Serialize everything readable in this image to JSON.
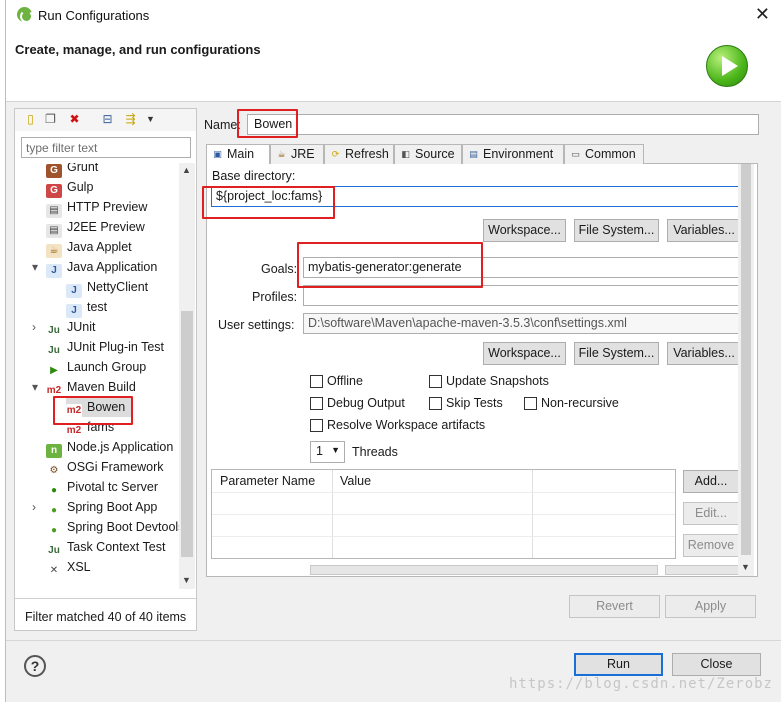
{
  "window": {
    "title": "Run Configurations",
    "close_glyph": "✕"
  },
  "header": {
    "title": "Create, manage, and run configurations",
    "run_icon": "run-icon"
  },
  "left": {
    "filter_placeholder": "type filter text",
    "status": "Filter matched 40 of 40 items",
    "items": [
      {
        "label": "Grunt",
        "icon": "G",
        "bg": "#a0522d",
        "fg": "#fff"
      },
      {
        "label": "Gulp",
        "icon": "G",
        "bg": "#cf4647",
        "fg": "#fff"
      },
      {
        "label": "HTTP Preview",
        "icon": "▤",
        "bg": "#e6e6e6",
        "fg": "#444"
      },
      {
        "label": "J2EE Preview",
        "icon": "▤",
        "bg": "#e6e6e6",
        "fg": "#444"
      },
      {
        "label": "Java Applet",
        "icon": "☕",
        "bg": "#f4e3c3",
        "fg": "#8a5a00"
      },
      {
        "label": "Java Application",
        "icon": "J",
        "bg": "#dbe8f8",
        "fg": "#2c5aa0"
      },
      {
        "label": "NettyClient",
        "icon": "J",
        "bg": "#dbe8f8",
        "fg": "#2c5aa0"
      },
      {
        "label": "test",
        "icon": "J",
        "bg": "#dbe8f8",
        "fg": "#2c5aa0"
      },
      {
        "label": "JUnit",
        "icon": "Ju",
        "bg": "#ffffff",
        "fg": "#3a6a3a"
      },
      {
        "label": "JUnit Plug-in Test",
        "icon": "Ju",
        "bg": "#ffffff",
        "fg": "#3a6a3a"
      },
      {
        "label": "Launch Group",
        "icon": "▶",
        "bg": "#ffffff",
        "fg": "#2d8a0d"
      },
      {
        "label": "Maven Build",
        "icon": "m2",
        "bg": "#ffffff",
        "fg": "#c62828"
      },
      {
        "label": "Bowen",
        "icon": "m2",
        "bg": "#ffffff",
        "fg": "#c62828"
      },
      {
        "label": "fams",
        "icon": "m2",
        "bg": "#ffffff",
        "fg": "#c62828"
      },
      {
        "label": "Node.js Application",
        "icon": "n",
        "bg": "#6db33f",
        "fg": "#fff"
      },
      {
        "label": "OSGi Framework",
        "icon": "⚙",
        "bg": "#ffffff",
        "fg": "#7a4a20"
      },
      {
        "label": "Pivotal tc Server",
        "icon": "●",
        "bg": "#ffffff",
        "fg": "#2d8a0d"
      },
      {
        "label": "Spring Boot App",
        "icon": "●",
        "bg": "#ffffff",
        "fg": "#4f9c24"
      },
      {
        "label": "Spring Boot Devtools",
        "icon": "●",
        "bg": "#ffffff",
        "fg": "#4f9c24"
      },
      {
        "label": "Task Context Test",
        "icon": "Ju",
        "bg": "#ffffff",
        "fg": "#3a6a3a"
      },
      {
        "label": "XSL",
        "icon": "✕",
        "bg": "#ffffff",
        "fg": "#444"
      }
    ]
  },
  "config": {
    "name_label": "Name:",
    "name_value": "Bowen",
    "tabs": [
      {
        "label": "Main",
        "icon": "▣"
      },
      {
        "label": "JRE",
        "icon": "☕"
      },
      {
        "label": "Refresh",
        "icon": "⟳"
      },
      {
        "label": "Source",
        "icon": "◧"
      },
      {
        "label": "Environment",
        "icon": "▤"
      },
      {
        "label": "Common",
        "icon": "▭"
      }
    ],
    "base_dir_label": "Base directory:",
    "base_dir_value": "${project_loc:fams}",
    "workspace_btn": "Workspace...",
    "filesystem_btn": "File System...",
    "variables_btn": "Variables...",
    "goals_label": "Goals:",
    "goals_value": "mybatis-generator:generate",
    "profiles_label": "Profiles:",
    "profiles_value": "",
    "user_settings_label": "User settings:",
    "user_settings_value": "D:\\software\\Maven\\apache-maven-3.5.3\\conf\\settings.xml",
    "checkboxes": {
      "offline": "Offline",
      "update_snapshots": "Update Snapshots",
      "debug_output": "Debug Output",
      "skip_tests": "Skip Tests",
      "non_recursive": "Non-recursive",
      "resolve_ws": "Resolve Workspace artifacts"
    },
    "threads_value": "1",
    "threads_label": "Threads",
    "param_cols": [
      "Parameter Name",
      "Value"
    ],
    "add_btn": "Add...",
    "edit_btn": "Edit...",
    "remove_btn": "Remove",
    "revert_btn": "Revert",
    "apply_btn": "Apply"
  },
  "footer": {
    "run_btn": "Run",
    "close_btn": "Close",
    "help": "?",
    "watermark": "https://blog.csdn.net/Zerobz"
  }
}
